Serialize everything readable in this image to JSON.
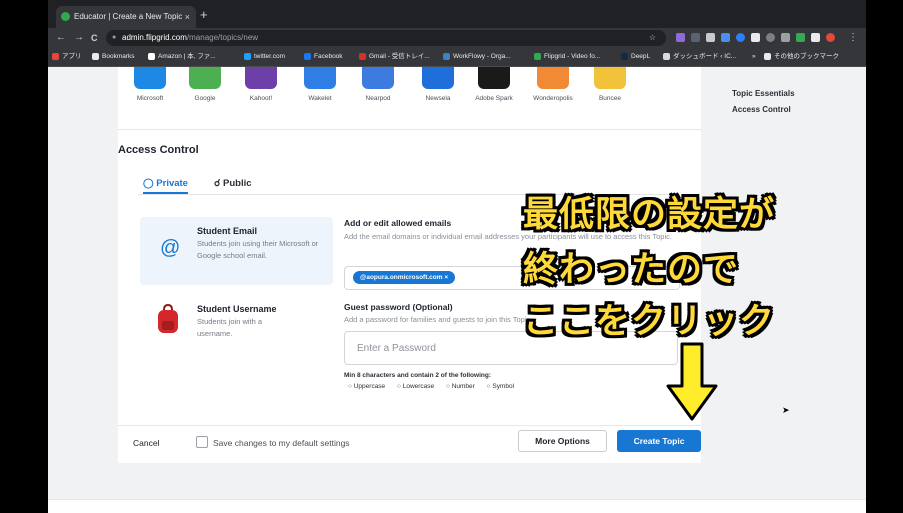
{
  "browser": {
    "tab_title": "Educator | Create a New Topic",
    "tab_close": "×",
    "new_tab": "+",
    "nav": {
      "back": "←",
      "forward": "→",
      "reload": "C"
    },
    "url_host": "admin.flipgrid.com",
    "url_path": "/manage/topics/new",
    "star": "☆",
    "menu": "⋮",
    "bookmarks": [
      {
        "label": "アプリ",
        "color": "#e0493b"
      },
      {
        "label": "Bookmarks",
        "color": "#e8eaed"
      },
      {
        "label": "Amazon | 本, ファ...",
        "color": "#ffffff"
      },
      {
        "label": "twitter.com",
        "color": "#1da1f2"
      },
      {
        "label": "Facebook",
        "color": "#1877f2"
      },
      {
        "label": "Gmail - 受信トレイ...",
        "color": "#d93025"
      },
      {
        "label": "WorkFlowy - Orga...",
        "color": "#3b82c4"
      },
      {
        "label": "Flipgrid - Video fo...",
        "color": "#33a852"
      },
      {
        "label": "DeepL",
        "color": "#0f2b46"
      },
      {
        "label": "ダッシュボード ‹ IC...",
        "color": "#d7d9dc"
      },
      {
        "label": "»",
        "color": "#35363a"
      },
      {
        "label": "その他のブックマーク",
        "color": "#e8eaed"
      }
    ]
  },
  "apps": [
    {
      "label": "Microsoft",
      "color": "#1e88e5"
    },
    {
      "label": "Google",
      "color": "#4caf50"
    },
    {
      "label": "Kahoot!",
      "color": "#6d3fa8"
    },
    {
      "label": "Wakelet",
      "color": "#2f7ee6"
    },
    {
      "label": "Nearpod",
      "color": "#3e7be0"
    },
    {
      "label": "Newsela",
      "color": "#1e6fd9"
    },
    {
      "label": "Adobe Spark",
      "color": "#1a1a1a"
    },
    {
      "label": "Wonderopolis",
      "color": "#f08a35"
    },
    {
      "label": "Buncee",
      "color": "#f1c23a"
    }
  ],
  "toc": {
    "item1": "Topic Essentials",
    "item2": "Access Control"
  },
  "access": {
    "title": "Access Control",
    "tab_private": "Private",
    "tab_public": "Public",
    "email_option": {
      "icon": "@",
      "title": "Student Email",
      "desc": "Students join using their Microsoft or Google school email."
    },
    "username_option": {
      "title": "Student Username",
      "desc": "Students join with a username."
    },
    "emails_label": "Add or edit allowed emails",
    "emails_help": "Add the email domains or individual email addresses your participants will use to access this Topic.",
    "chip": "@aopura.onmicrosoft.com ×",
    "password_label": "Guest password (Optional)",
    "password_help": "Add a password for families and guests to join this Topic.",
    "password_placeholder": "Enter a Password",
    "req_title": "Min 8 characters and contain 2 of the following:",
    "req_options": [
      "Uppercase",
      "Lowercase",
      "Number",
      "Symbol"
    ]
  },
  "footer": {
    "cancel": "Cancel",
    "save_default": "Save changes to my default settings",
    "more_options": "More Options",
    "create_topic": "Create Topic"
  },
  "overlay": {
    "line1": "最低限の設定が",
    "line2": "終わったので",
    "line3": "ここをクリック",
    "color": "#ffd83a"
  },
  "colors": {
    "accent": "#1877d2"
  }
}
